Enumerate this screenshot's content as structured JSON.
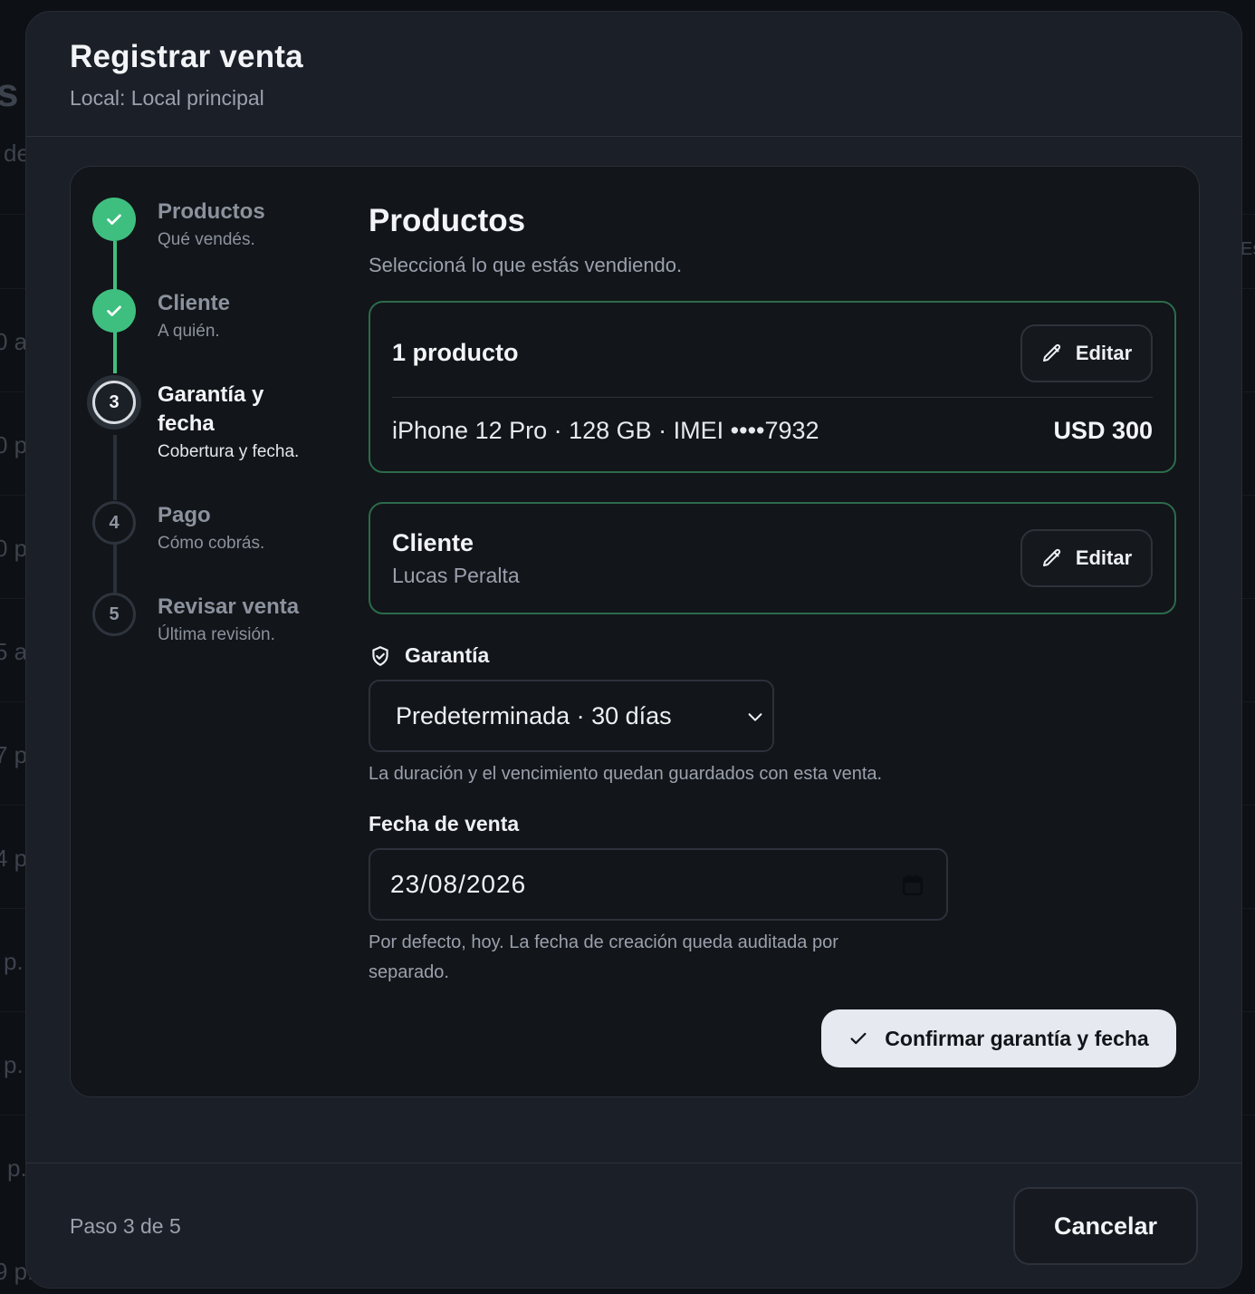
{
  "background": {
    "fragments": [
      "s",
      "de",
      "0 a",
      "0 p",
      "0 p",
      "5 a",
      "7 p",
      "4 p",
      "p.",
      "p.",
      "p.",
      "9 p.",
      "Es"
    ]
  },
  "modal": {
    "title": "Registrar venta",
    "subtitle": "Local: Local principal"
  },
  "stepper": {
    "steps": [
      {
        "number": "1",
        "title": "Productos",
        "description": "Qué vendés.",
        "state": "done"
      },
      {
        "number": "2",
        "title": "Cliente",
        "description": "A quién.",
        "state": "done"
      },
      {
        "number": "3",
        "title": "Garantía y fecha",
        "description": "Cobertura y fecha.",
        "state": "current"
      },
      {
        "number": "4",
        "title": "Pago",
        "description": "Cómo cobrás.",
        "state": "todo"
      },
      {
        "number": "5",
        "title": "Revisar venta",
        "description": "Última revisión.",
        "state": "todo"
      }
    ]
  },
  "main": {
    "section_title": "Productos",
    "section_subtitle": "Seleccioná lo que estás vendiendo.",
    "products_card": {
      "heading": "1 producto",
      "edit_label": "Editar",
      "item": "iPhone 12 Pro · 128 GB · IMEI ••••7932",
      "price": "USD 300"
    },
    "client_card": {
      "heading": "Cliente",
      "name": "Lucas Peralta",
      "edit_label": "Editar"
    },
    "warranty": {
      "label": "Garantía",
      "selected": "Predeterminada · 30 días",
      "helper": "La duración y el vencimiento quedan guardados con esta venta."
    },
    "sale_date": {
      "label": "Fecha de venta",
      "value": "23/08/2026",
      "helper_line1": "Por defecto, hoy. La fecha de creación queda auditada por",
      "helper_line2": "separado."
    },
    "confirm_label": "Confirmar garantía y fecha"
  },
  "footer": {
    "step_text": "Paso 3 de 5",
    "cancel_label": "Cancelar"
  },
  "colors": {
    "accent_green": "#3fbf7f",
    "card_border": "#2c6b4b",
    "modal_bg": "#1b1f27",
    "panel_bg": "#121519"
  }
}
